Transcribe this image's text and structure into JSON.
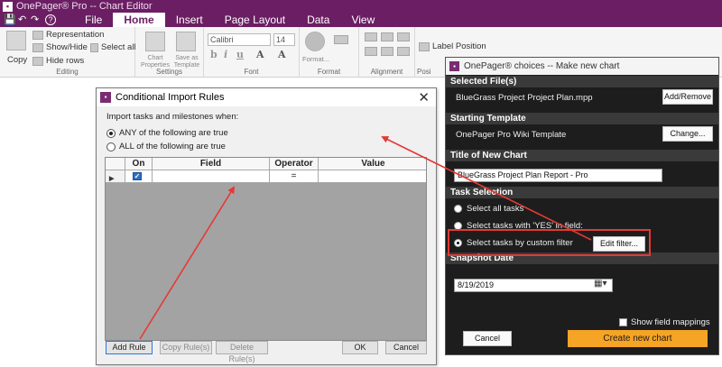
{
  "app": {
    "title": "OnePager® Pro --  Chart Editor",
    "logo_icon": "onepager-logo-icon",
    "quick_access": {
      "save": "💾",
      "undo": "↶",
      "redo": "↷",
      "help": "?"
    },
    "menu": [
      "File",
      "Home",
      "Insert",
      "Page Layout",
      "Data",
      "View"
    ],
    "active_menu": "Home"
  },
  "ribbon": {
    "editing": {
      "copy": "Copy",
      "representation": "Representation",
      "show_hide": "Show/Hide",
      "select_all": "Select all",
      "hide_rows": "Hide rows",
      "label": "Editing"
    },
    "settings": {
      "chart_properties": "Chart Properties",
      "save_as_template": "Save as Template",
      "label": "Settings"
    },
    "font": {
      "family": "Calibri",
      "size": "14",
      "bold": "b",
      "italic": "i",
      "underline": "u",
      "label": "Font"
    },
    "format": {
      "button": "Format...",
      "label": "Format"
    },
    "alignment": {
      "label": "Alignment"
    },
    "position": {
      "label_position": "Label Position",
      "label": "Posi"
    }
  },
  "cir_dialog": {
    "title": "Conditional Import Rules",
    "close": "✕",
    "prompt": "Import tasks and milestones when:",
    "options": [
      {
        "label": "ANY of the following are true",
        "selected": true
      },
      {
        "label": "ALL of the following are true",
        "selected": false
      }
    ],
    "grid": {
      "columns": [
        "",
        "On",
        "Field",
        "Operator",
        "Value"
      ],
      "rows": [
        {
          "pointer": "▶",
          "on": "✓",
          "field": "",
          "operator": "=",
          "value": ""
        }
      ]
    },
    "buttons": {
      "add_rule": "Add Rule",
      "copy_rule": "Copy Rule(s)",
      "delete_rule": "Delete Rule(s)",
      "ok": "OK",
      "cancel": "Cancel"
    }
  },
  "choices_dialog": {
    "title": "OnePager® choices  --  Make new chart",
    "sections": {
      "files": "Selected File(s)",
      "template": "Starting Template",
      "chart_title": "Title of New Chart",
      "task_selection": "Task Selection",
      "snapshot": "Snapshot Date"
    },
    "file_name": "BlueGrass Project Project Plan.mpp",
    "add_remove": "Add/Remove",
    "template_name": "OnePager Pro Wiki Template",
    "change": "Change...",
    "chart_title_value": "BlueGrass Project Plan Report - Pro",
    "task_options": [
      {
        "label": "Select all tasks",
        "selected": false
      },
      {
        "label": "Select tasks with 'YES' in field:",
        "selected": false
      },
      {
        "label": "Select tasks by custom filter",
        "selected": true
      }
    ],
    "edit_filter": "Edit filter...",
    "snapshot_date": "8/19/2019",
    "show_field_mappings": "Show field mappings",
    "cancel": "Cancel",
    "create": "Create new chart"
  },
  "colors": {
    "brand": "#6b1e63",
    "accent": "#f6a425",
    "annotation": "#e53935",
    "panel_bg": "#1d1d1d"
  }
}
